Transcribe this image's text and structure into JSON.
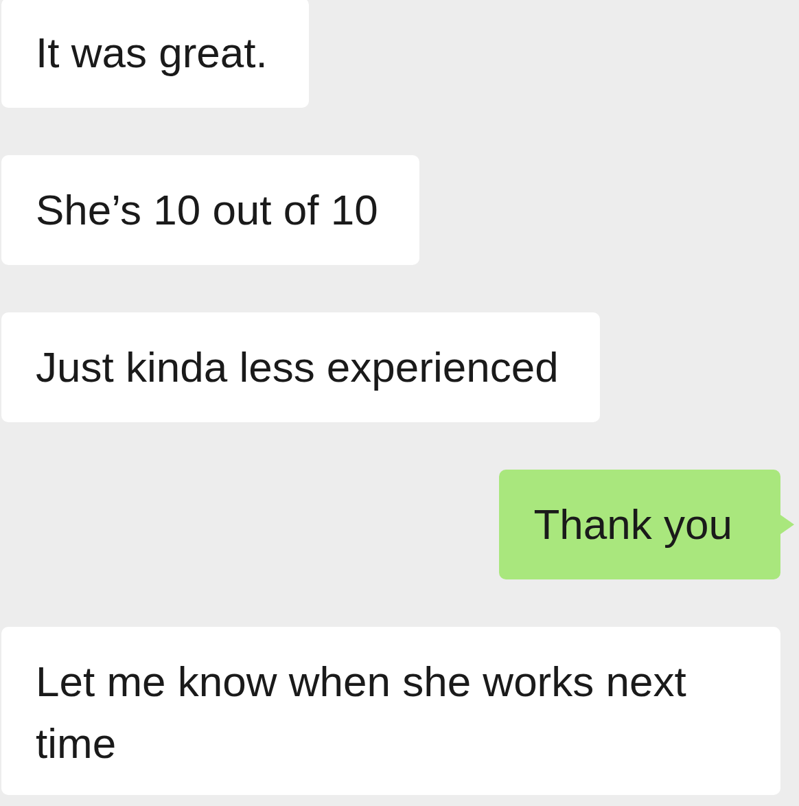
{
  "messages": [
    {
      "kind": "received",
      "text": "It was great."
    },
    {
      "kind": "received",
      "text": "She’s 10 out of 10"
    },
    {
      "kind": "received",
      "text": "Just kinda less experienced"
    },
    {
      "kind": "sent",
      "text": "Thank you"
    },
    {
      "kind": "received",
      "text": "Let me know when she works next time"
    }
  ]
}
